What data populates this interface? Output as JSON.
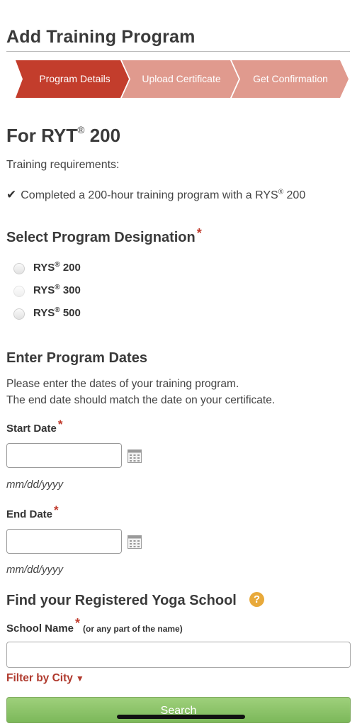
{
  "header": {
    "title": "Add Training Program"
  },
  "steps": [
    {
      "label": "Program Details",
      "active": true,
      "color": "#c33d2c"
    },
    {
      "label": "Upload Certificate",
      "active": false,
      "color": "#e09a8e"
    },
    {
      "label": "Get Confirmation",
      "active": false,
      "color": "#e09a8e"
    }
  ],
  "designation_section": {
    "title_prefix": "For RYT",
    "title_reg": "®",
    "title_suffix": " 200",
    "requirements_label": "Training requirements:",
    "requirement_text_a": "Completed a 200-hour training program with a RYS",
    "requirement_reg": "®",
    "requirement_text_b": " 200"
  },
  "program_designation": {
    "title": "Select Program Designation",
    "required_mark": "*",
    "options": [
      {
        "prefix": "RYS",
        "reg": "®",
        "suffix": " 200"
      },
      {
        "prefix": "RYS",
        "reg": "®",
        "suffix": " 300"
      },
      {
        "prefix": "RYS",
        "reg": "®",
        "suffix": " 500"
      }
    ]
  },
  "program_dates": {
    "title": "Enter Program Dates",
    "description_line1": "Please enter the dates of your training program.",
    "description_line2": "The end date should match the date on your certificate.",
    "start_label": "Start Date",
    "end_label": "End Date",
    "required_mark": "*",
    "start_value": "",
    "end_value": "",
    "date_format_hint": "mm/dd/yyyy"
  },
  "school_search": {
    "title": "Find your Registered Yoga School",
    "help_icon": "?",
    "school_name_label": "School Name",
    "required_mark": "*",
    "school_name_note": "(or any part of the name)",
    "school_name_value": "",
    "filter_label": "Filter by City",
    "filter_icon": "▼",
    "search_button": "Search"
  },
  "icons": {
    "check": "✔",
    "calendar": "calendar-icon",
    "help": "question-icon"
  },
  "colors": {
    "accent_red": "#c33d2c",
    "step_inactive": "#e09a8e",
    "search_green": "#8cc56a",
    "help_orange": "#e8a93a"
  }
}
